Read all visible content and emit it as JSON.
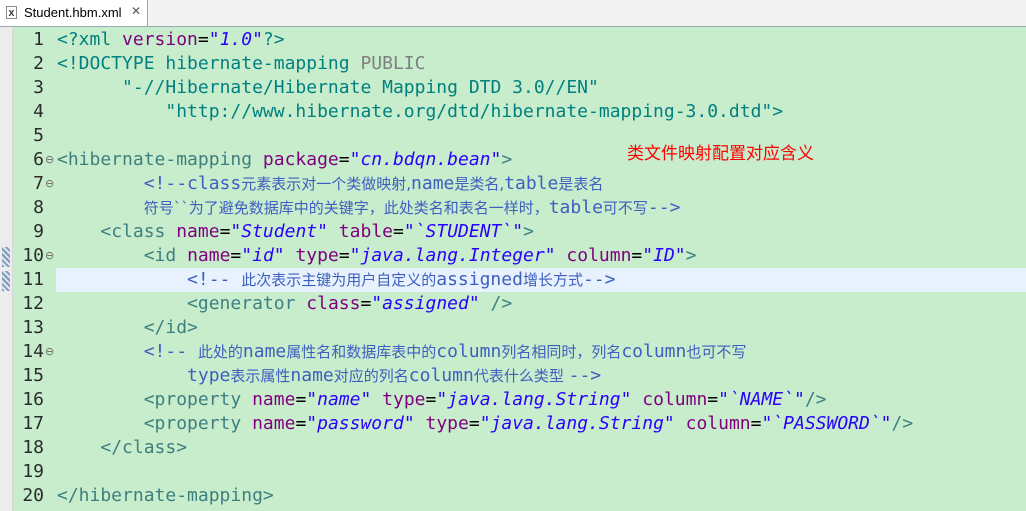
{
  "tab": {
    "label": "Student.hbm.xml",
    "close": "✕",
    "icon": "xml-file-icon"
  },
  "annotation": "类文件映射配置对应含义",
  "lines": [
    {
      "n": "1"
    },
    {
      "n": "2"
    },
    {
      "n": "3"
    },
    {
      "n": "4"
    },
    {
      "n": "5"
    },
    {
      "n": "6"
    },
    {
      "n": "7"
    },
    {
      "n": "8"
    },
    {
      "n": "9"
    },
    {
      "n": "10"
    },
    {
      "n": "11"
    },
    {
      "n": "12"
    },
    {
      "n": "13"
    },
    {
      "n": "14"
    },
    {
      "n": "15"
    },
    {
      "n": "16"
    },
    {
      "n": "17"
    },
    {
      "n": "18"
    },
    {
      "n": "19"
    },
    {
      "n": "20"
    }
  ],
  "code": {
    "l1": [
      "<?xml ",
      "version",
      "=",
      "\"1.0\"",
      "?>"
    ],
    "l2": [
      "<!DOCTYPE hibernate-mapping ",
      "PUBLIC"
    ],
    "l3": "\"-//Hibernate/Hibernate Mapping DTD 3.0//EN\"",
    "l4": "\"http://www.hibernate.org/dtd/hibernate-mapping-3.0.dtd\">",
    "l6": [
      "<hibernate-mapping ",
      "package",
      "=",
      "\"cn.bdqn.bean\"",
      ">"
    ],
    "l7": [
      "<!--class",
      "元素表示对一个类做映射,",
      "name",
      "是类名,",
      "table",
      "是表名"
    ],
    "l8": [
      "符号``为了避免数据库中的关键字，此处类名和表名一样时，",
      "table",
      "可不写",
      "-->"
    ],
    "l9": [
      "<class ",
      "name",
      "=",
      "\"Student\"",
      " table",
      "=",
      "\"`STUDENT`\"",
      ">"
    ],
    "l10": [
      "<id ",
      "name",
      "=",
      "\"id\"",
      " type",
      "=",
      "\"java.lang.Integer\"",
      " column",
      "=",
      "\"ID\"",
      ">"
    ],
    "l11": [
      "<!-- ",
      "此次表示主键为用户自定义的",
      "assigned",
      "增长方式",
      "-->"
    ],
    "l12": [
      "<generator ",
      "class",
      "=",
      "\"assigned\"",
      " />"
    ],
    "l13": "</id>",
    "l14": [
      "<!-- ",
      "此处的",
      "name",
      "属性名和数据库表中的",
      "column",
      "列名相同时，列名",
      "column",
      "也可不写"
    ],
    "l15": [
      "type",
      "表示属性",
      "name",
      "对应的列名",
      "column",
      "代表什么类型 ",
      "-->"
    ],
    "l16": [
      "<property ",
      "name",
      "=",
      "\"name\"",
      " type",
      "=",
      "\"java.lang.String\"",
      " column",
      "=",
      "\"`NAME`\"",
      "/>"
    ],
    "l17": [
      "<property ",
      "name",
      "=",
      "\"password\"",
      " type",
      "=",
      "\"java.lang.String\"",
      " column",
      "=",
      "\"`PASSWORD`\"",
      "/>"
    ],
    "l18": "</class>",
    "l20": "</hibernate-mapping>"
  },
  "colors": {
    "background": "#c7edcc",
    "tag": "#3f7f7f",
    "attr": "#7f007f",
    "value": "#2a00ff",
    "comment": "#3f5fbf",
    "annotation": "#ff0000",
    "current_line": "#e8f2fe"
  }
}
